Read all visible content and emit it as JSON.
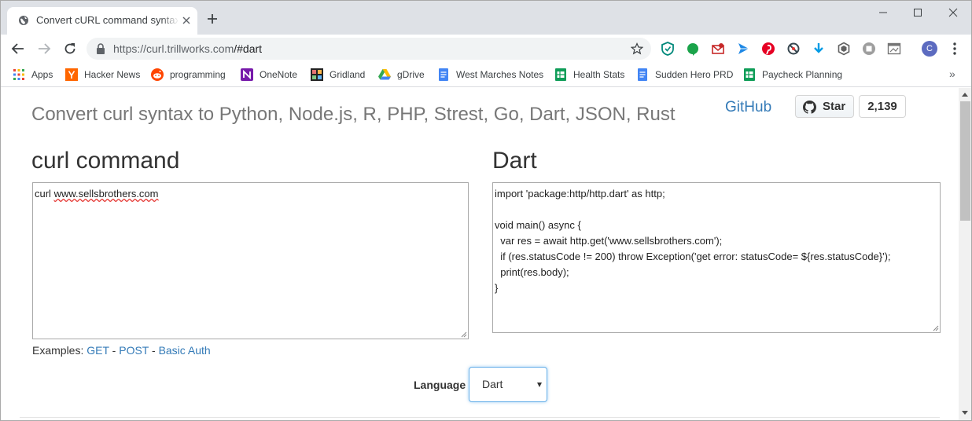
{
  "browser": {
    "tab_title": "Convert cURL command syntax to",
    "url_host": "https://curl.trillworks.com",
    "url_path": "/#dart",
    "profile_initial": "C",
    "bookmarks": [
      {
        "label": "Apps",
        "icon": "apps-grid-icon"
      },
      {
        "label": "Hacker News",
        "icon": "hacker-news-icon"
      },
      {
        "label": "programming",
        "icon": "reddit-icon"
      },
      {
        "label": "OneNote",
        "icon": "onenote-icon"
      },
      {
        "label": "Gridland",
        "icon": "gridland-icon"
      },
      {
        "label": "gDrive",
        "icon": "google-drive-icon"
      },
      {
        "label": "West Marches Notes",
        "icon": "google-docs-icon"
      },
      {
        "label": "Health Stats",
        "icon": "google-sheets-icon"
      },
      {
        "label": "Sudden Hero PRD",
        "icon": "google-docs-icon"
      },
      {
        "label": "Paycheck Planning",
        "icon": "google-sheets-icon"
      }
    ],
    "more_bookmarks": "»"
  },
  "page": {
    "headline": "Convert curl syntax to Python, Node.js, R, PHP, Strest, Go, Dart, JSON, Rust",
    "github_label": "GitHub",
    "star_label": "Star",
    "star_count": "2,139",
    "curl_heading": "curl command",
    "output_heading": "Dart",
    "curl_input_prefix": "curl ",
    "curl_input_url": "www.sellsbrothers.com",
    "output_code": "import 'package:http/http.dart' as http;\n\nvoid main() async {\n  var res = await http.get('www.sellsbrothers.com');\n  if (res.statusCode != 200) throw Exception('get error: statusCode= ${res.statusCode}');\n  print(res.body);\n}",
    "examples_label": "Examples:",
    "examples": [
      "GET",
      "POST",
      "Basic Auth"
    ],
    "separator": " - ",
    "language_label": "Language",
    "language_value": "Dart"
  },
  "colors": {
    "link": "#337ab7",
    "headline": "#777777",
    "tabstrip": "#dee1e6"
  }
}
